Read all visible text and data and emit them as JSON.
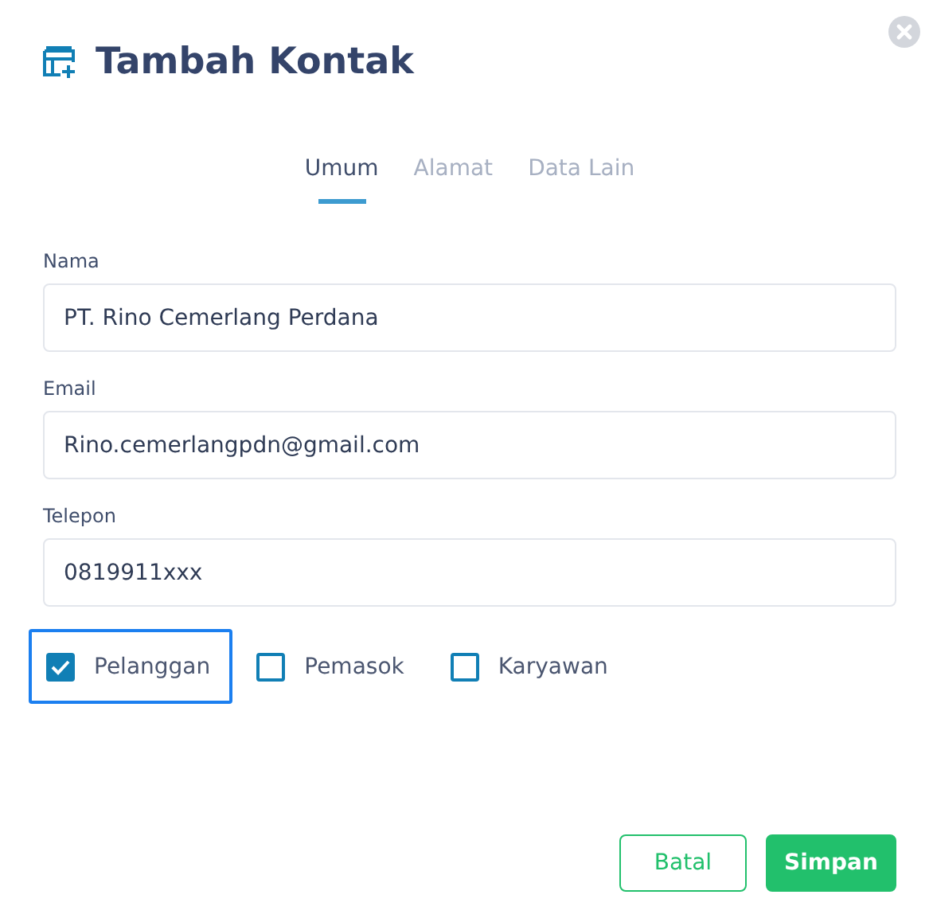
{
  "dialog": {
    "title": "Tambah Kontak"
  },
  "tabs": [
    {
      "label": "Umum",
      "selected": true
    },
    {
      "label": "Alamat",
      "selected": false
    },
    {
      "label": "Data Lain",
      "selected": false
    }
  ],
  "fields": [
    {
      "label": "Nama",
      "value": "PT. Rino Cemerlang Perdana"
    },
    {
      "label": "Email",
      "value": "Rino.cemerlangpdn@gmail.com"
    },
    {
      "label": "Telepon",
      "value": "0819911xxx"
    }
  ],
  "roles": [
    {
      "label": "Pelanggan",
      "checked": true,
      "focused": true
    },
    {
      "label": "Pemasok",
      "checked": false,
      "focused": false
    },
    {
      "label": "Karyawan",
      "checked": false,
      "focused": false
    }
  ],
  "buttons": [
    {
      "label": "Batal",
      "kind": "secondary"
    },
    {
      "label": "Simpan",
      "kind": "primary"
    }
  ]
}
